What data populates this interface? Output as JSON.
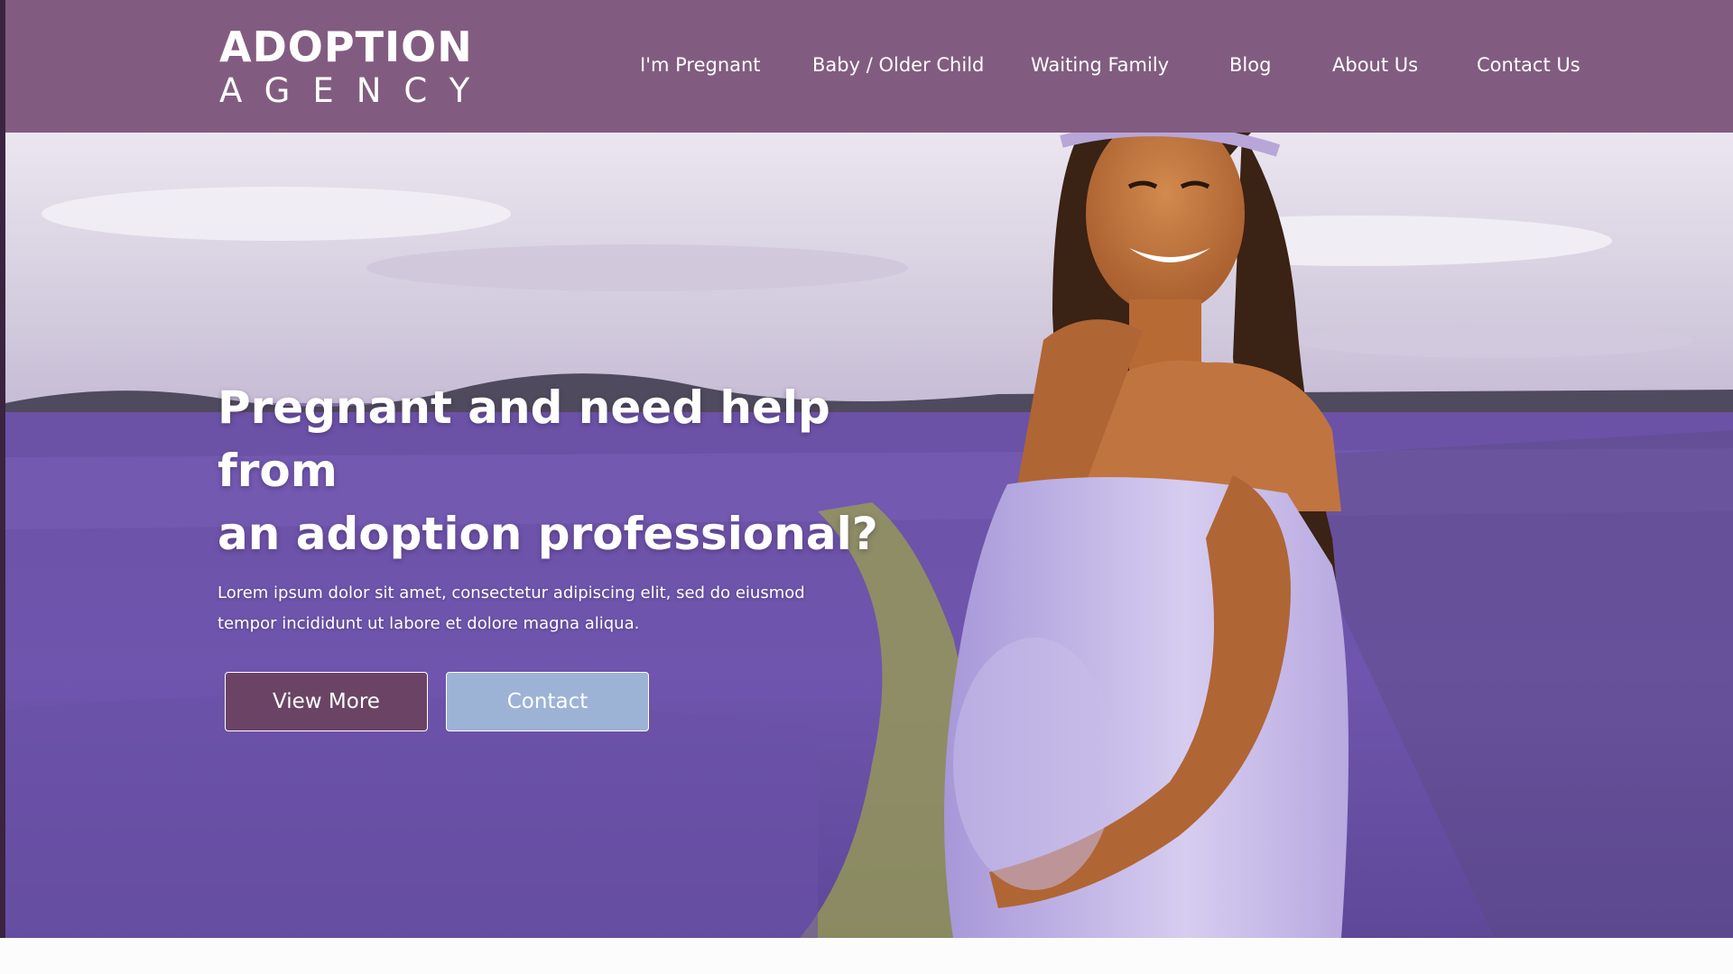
{
  "logo": {
    "line1": "ADOPTION",
    "line2": "AGENCY"
  },
  "nav": {
    "items": [
      {
        "label": "I'm Pregnant"
      },
      {
        "label": "Baby / Older Child"
      },
      {
        "label": "Waiting Family"
      },
      {
        "label": "Blog"
      },
      {
        "label": "About Us"
      },
      {
        "label": "Contact Us"
      }
    ]
  },
  "hero": {
    "title_line1": "Pregnant and need help from",
    "title_line2": "an adoption professional?",
    "desc_line1": "Lorem ipsum dolor sit amet, consectetur adipiscing elit, sed do eiusmod",
    "desc_line2": "tempor incididunt ut labore et dolore magna aliqua.",
    "view_more_label": "View More",
    "contact_label": "Contact"
  },
  "colors": {
    "header_bg": "#825c80",
    "view_more_bg": "#6b4465",
    "contact_bg": "#9db3d6"
  }
}
